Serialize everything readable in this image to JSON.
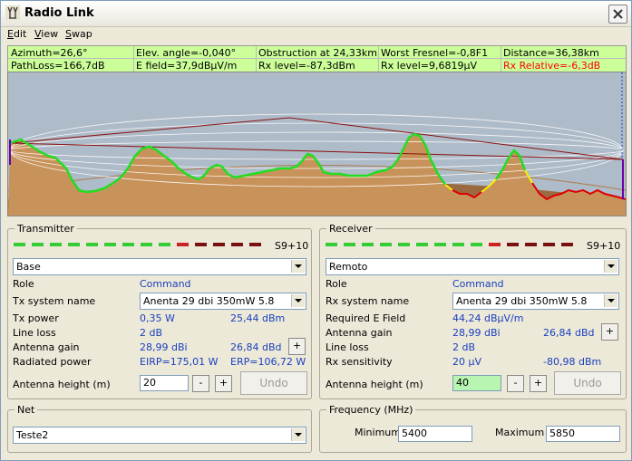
{
  "window": {
    "title": "Radio Link"
  },
  "menu": [
    {
      "label": "Edit",
      "ul": "E"
    },
    {
      "label": "View",
      "ul": "V"
    },
    {
      "label": "Swap",
      "ul": "S"
    }
  ],
  "info": {
    "azimuth": "Azimuth=26,6°",
    "elev": "Elev. angle=-0,040°",
    "obstruction": "Obstruction at 24,33km",
    "fresnel": "Worst Fresnel=-0,8F1",
    "distance": "Distance=36,38km",
    "pathloss": "PathLoss=166,7dB",
    "efield": "E field=37,9dBμV/m",
    "rxlevel_dbm": "Rx level=-87,3dBm",
    "rxlevel_uv": "Rx level=9,6819μV",
    "rx_relative": "Rx Relative=-6,3dB",
    "rx_relative_color": "#ff0000"
  },
  "transmitter": {
    "title": "Transmitter",
    "meter_value": "S9+10",
    "meter_level": 0.64,
    "station": "Base",
    "role_label": "Role",
    "role_value": "Command",
    "system_label": "Tx system name",
    "system_value": "Anenta 29 dbi 350mW 5.8",
    "power_label": "Tx power",
    "power_w": "0,35 W",
    "power_dbm": "25,44 dBm",
    "lineloss_label": "Line loss",
    "lineloss_value": "2 dB",
    "gain_label": "Antenna gain",
    "gain_dbi": "28,99 dBi",
    "gain_dbd": "26,84 dBd",
    "radiated_label": "Radiated power",
    "eirp": "EIRP=175,01 W",
    "erp": "ERP=106,72 W",
    "height_label": "Antenna height (m)",
    "height_value": "20",
    "plus": "+",
    "minus": "-",
    "undo": "Undo"
  },
  "receiver": {
    "title": "Receiver",
    "meter_value": "S9+10",
    "meter_level": 0.64,
    "station": "Remoto",
    "role_label": "Role",
    "role_value": "Command",
    "system_label": "Rx system name",
    "system_value": "Anenta 29 dbi 350mW 5.8",
    "efield_label": "Required E Field",
    "efield_value": "44,24 dBμV/m",
    "gain_label": "Antenna gain",
    "gain_dbi": "28,99 dBi",
    "gain_dbd": "26,84 dBd",
    "lineloss_label": "Line loss",
    "lineloss_value": "2 dB",
    "sens_label": "Rx sensitivity",
    "sens_uv": "20 μV",
    "sens_dbm": "-80,98 dBm",
    "height_label": "Antenna height (m)",
    "height_value": "40",
    "plus": "+",
    "minus": "-",
    "undo": "Undo"
  },
  "net": {
    "title": "Net",
    "value": "Teste2"
  },
  "frequency": {
    "title": "Frequency (MHz)",
    "min_label": "Minimum",
    "min_value": "5400",
    "max_label": "Maximum",
    "max_value": "5850"
  },
  "colors": {
    "info_bg": "#ccff99",
    "profile_bg": "#aebbc8",
    "terrain": "#c8935a",
    "meter_green": "#33cc33",
    "meter_red": "#cc2222",
    "meter_dark": "#7a1010",
    "link_blue": "#1a3fbf"
  }
}
